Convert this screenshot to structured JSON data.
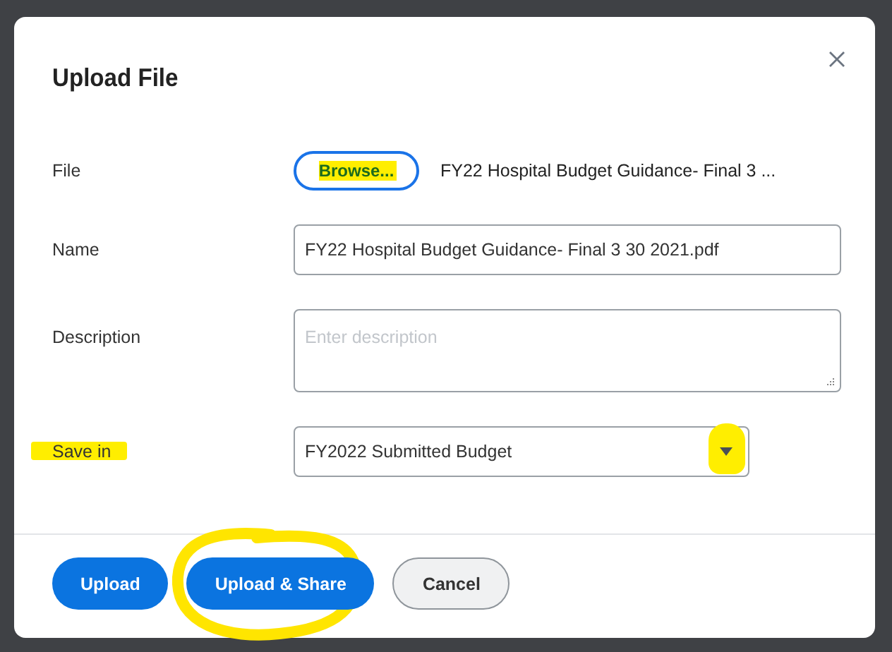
{
  "dialog": {
    "title": "Upload File"
  },
  "fields": [
    {
      "kind": "file",
      "label": "File",
      "button": {
        "label": "Browse...",
        "highlighted": true
      },
      "file_name": "FY22 Hospital Budget Guidance- Final 3  ..."
    },
    {
      "kind": "text",
      "label": "Name",
      "value": "FY22 Hospital Budget Guidance- Final 3 30 2021.pdf"
    },
    {
      "kind": "textarea",
      "label": "Description",
      "placeholder": "Enter description"
    },
    {
      "kind": "select",
      "label": "Save in",
      "label_highlighted": true,
      "value": "FY2022 Submitted Budget",
      "arrow_highlighted": true
    }
  ],
  "buttons": [
    {
      "label": "Upload",
      "kind": "primary",
      "circled": false
    },
    {
      "label": "Upload & Share",
      "kind": "primary",
      "circled": true
    },
    {
      "label": "Cancel",
      "kind": "secondary",
      "circled": false
    }
  ]
}
